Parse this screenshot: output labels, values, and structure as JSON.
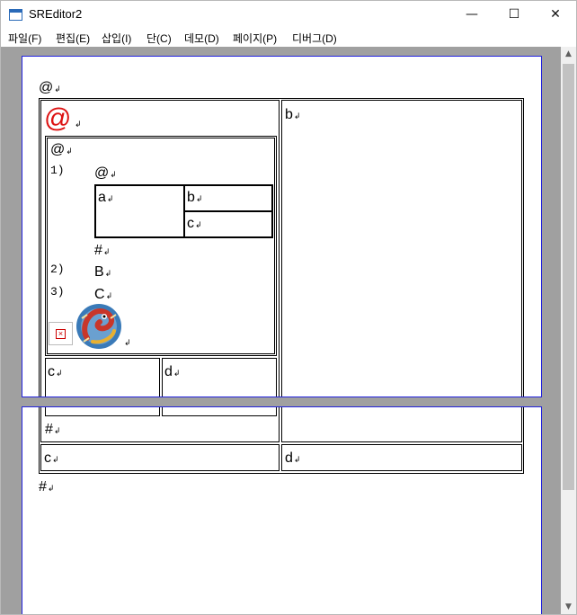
{
  "window": {
    "title": "SREditor2",
    "minimize_glyph": "—",
    "maximize_glyph": "☐",
    "close_glyph": "✕"
  },
  "menu": [
    "파일(F)",
    "편집(E)",
    "삽입(I)",
    "단(C)",
    "데모(D)",
    "페이지(P)",
    "디버그(D)"
  ],
  "scrollbar": {
    "up_glyph": "▲",
    "down_glyph": "▼"
  },
  "page1": {
    "para_top": "@",
    "outer_left_head": "@",
    "outer_right": "b",
    "inner_head": "@",
    "list": [
      {
        "marker": "1)",
        "text": ""
      },
      {
        "marker": "2)",
        "text": "B"
      },
      {
        "marker": "3)",
        "text": "C"
      }
    ],
    "item1_para": "@",
    "grid": {
      "a": "a",
      "b": "b",
      "c": "c"
    },
    "after_grid": "#",
    "bottom_row": {
      "left": "c",
      "right": "d"
    }
  },
  "page2": {
    "hash_cell": "#",
    "row": {
      "left": "c",
      "right": "d"
    },
    "para_end": "#"
  },
  "return_mark": "↲",
  "colors": {
    "page_border": "#2222dd",
    "big_at": "#dd1111",
    "background": "#a0a0a0"
  },
  "icons": {
    "broken_image": "broken-image-icon",
    "image": "dragon-image"
  }
}
